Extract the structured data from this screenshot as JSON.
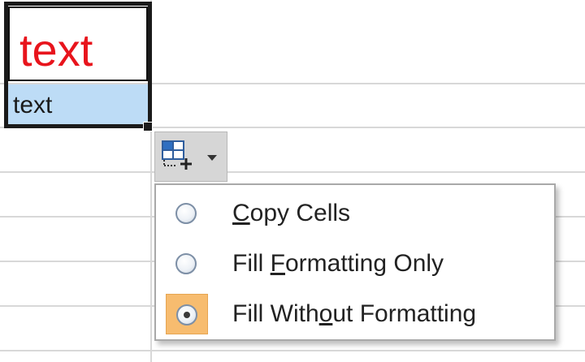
{
  "cells": {
    "top_text": "text",
    "bottom_text": "text",
    "top_text_color": "#e8141c",
    "bottom_fill_color": "#bddcf6"
  },
  "autofill_button": {
    "icon": "autofill-options-icon",
    "arrow_icon": "dropdown-arrow-icon"
  },
  "menu": {
    "items": [
      {
        "label_pre": "",
        "label_accel": "C",
        "label_post": "opy Cells",
        "selected": false
      },
      {
        "label_pre": "Fill ",
        "label_accel": "F",
        "label_post": "ormatting Only",
        "selected": false
      },
      {
        "label_pre": "Fill With",
        "label_accel": "o",
        "label_post": "ut Formatting",
        "selected": true
      }
    ],
    "highlight_color": "#f7bc6f"
  }
}
